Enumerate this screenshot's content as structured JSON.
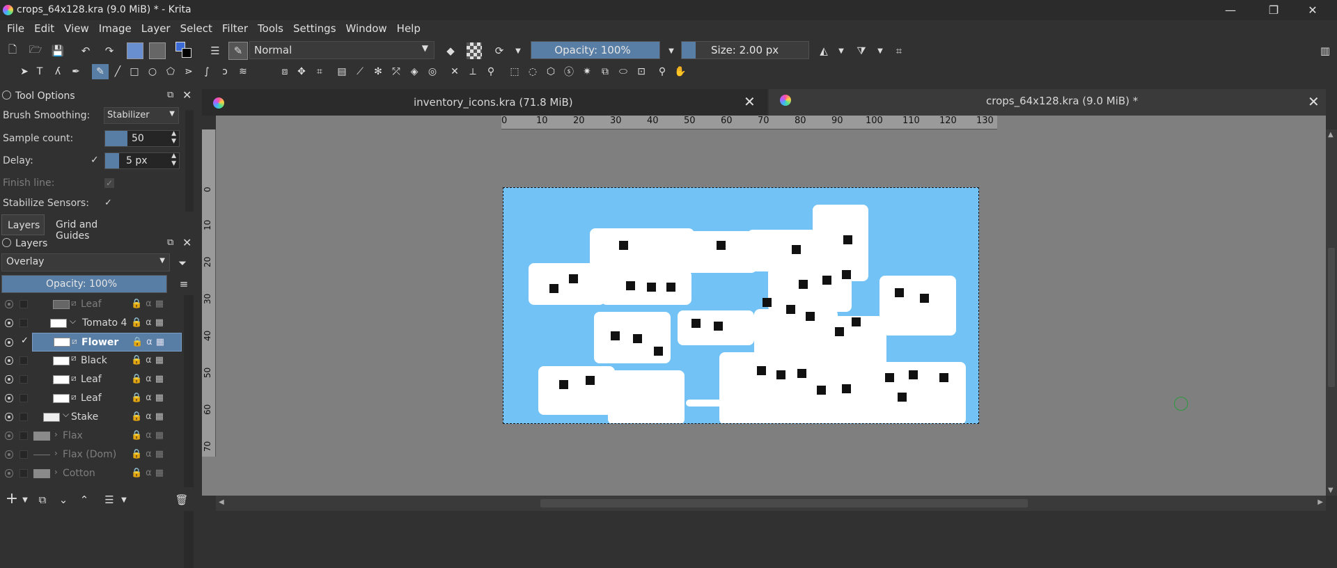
{
  "window": {
    "title": "crops_64x128.kra (9.0 MiB) * - Krita",
    "minimize_glyph": "—",
    "restore_glyph": "❐",
    "close_glyph": "✕"
  },
  "menu": [
    "File",
    "Edit",
    "View",
    "Image",
    "Layer",
    "Select",
    "Filter",
    "Tools",
    "Settings",
    "Window",
    "Help"
  ],
  "toolbar": {
    "blend_mode": "Normal",
    "opacity": "Opacity: 100%",
    "size": "Size: 2.00 px"
  },
  "tool_options": {
    "header": "Tool Options",
    "brush_smoothing_label": "Brush Smoothing:",
    "brush_smoothing_value": "Stabilizer",
    "sample_count_label": "Sample count:",
    "sample_count_value": "50",
    "delay_label": "Delay:",
    "delay_value": "5 px",
    "finish_line_label": "Finish line:",
    "stabilize_sensors_label": "Stabilize Sensors:"
  },
  "dock_tabs": {
    "layers": "Layers",
    "grid_guides": "Grid and Guides"
  },
  "layers_panel": {
    "header": "Layers",
    "blend_mode": "Overlay",
    "opacity": "Opacity:  100%",
    "layers": [
      {
        "name": "Leaf",
        "visible": false,
        "dim": true
      },
      {
        "name": "Tomato 4",
        "visible": true,
        "dim": false
      },
      {
        "name": "Flower",
        "visible": true,
        "dim": false,
        "selected": true
      },
      {
        "name": "Black",
        "visible": true,
        "dim": false
      },
      {
        "name": "Leaf",
        "visible": true,
        "dim": false
      },
      {
        "name": "Leaf",
        "visible": true,
        "dim": false
      },
      {
        "name": "Stake",
        "visible": true,
        "dim": false
      },
      {
        "name": "Flax",
        "visible": false,
        "dim": true
      },
      {
        "name": "Flax (Dom)",
        "visible": false,
        "dim": true
      },
      {
        "name": "Cotton",
        "visible": false,
        "dim": true
      }
    ]
  },
  "document_tabs": [
    {
      "label": "inventory_icons.kra (71.8 MiB)",
      "active": false
    },
    {
      "label": "crops_64x128.kra (9.0 MiB) *",
      "active": true
    }
  ],
  "ruler": {
    "horizontal": [
      "0",
      "10",
      "20",
      "30",
      "40",
      "50",
      "60",
      "70",
      "80",
      "90",
      "100",
      "110",
      "120",
      "130"
    ],
    "vertical": [
      "0",
      "10",
      "20",
      "30",
      "40",
      "50",
      "60",
      "70"
    ]
  },
  "colors": {
    "canvas_bg": "#7f7f7f",
    "image_bg": "#73c2f5",
    "accent": "#587ea5"
  }
}
